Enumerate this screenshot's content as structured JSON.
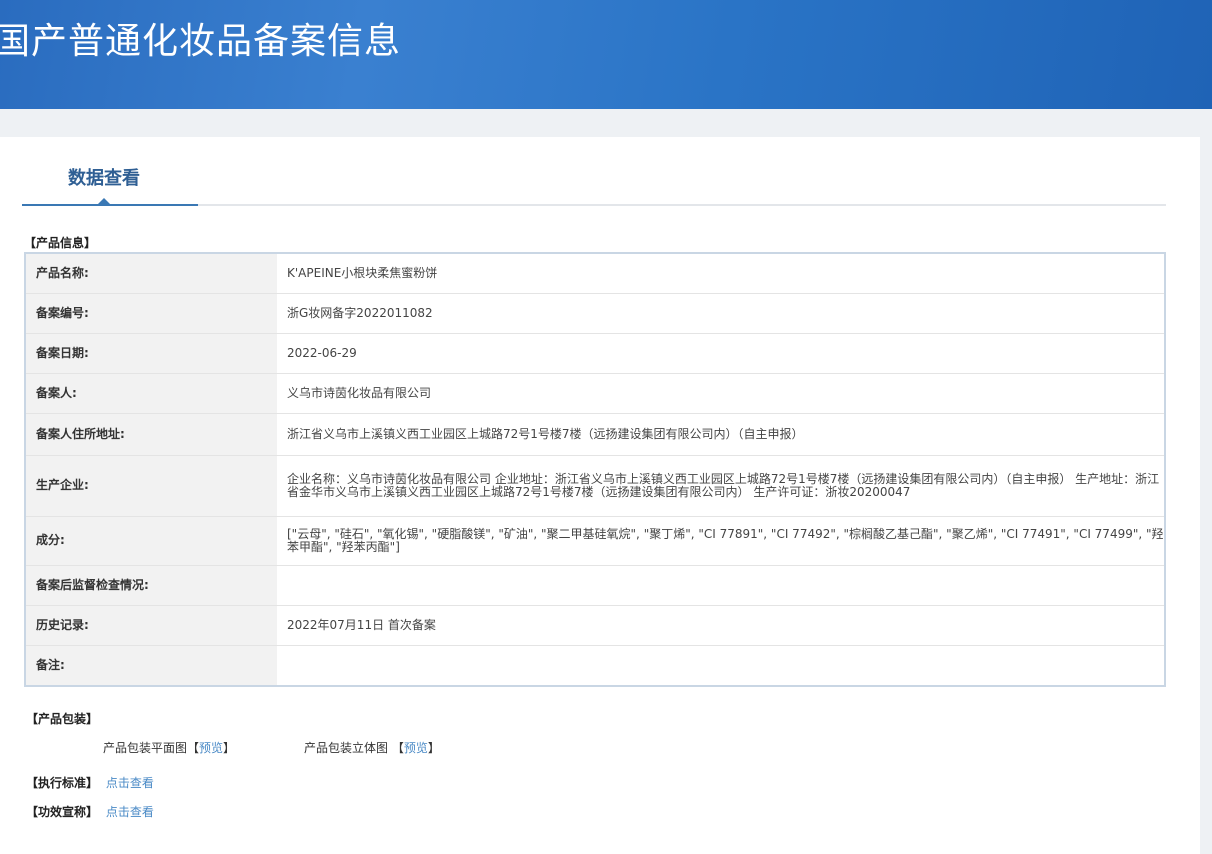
{
  "header": {
    "title": "国产普通化妆品备案信息"
  },
  "tab": {
    "label": "数据查看"
  },
  "product_info": {
    "section_title": "【产品信息】",
    "rows": [
      {
        "label": "产品名称:",
        "value": "K'APEINE小根块柔焦蜜粉饼"
      },
      {
        "label": "备案编号:",
        "value": "浙G妆网备字2022011082"
      },
      {
        "label": "备案日期:",
        "value": "2022-06-29"
      },
      {
        "label": "备案人:",
        "value": "义乌市诗茵化妆品有限公司"
      },
      {
        "label": "备案人住所地址:",
        "value": "浙江省义乌市上溪镇义西工业园区上城路72号1号楼7楼（远扬建设集团有限公司内）（自主申报）"
      },
      {
        "label": "生产企业:",
        "value": "企业名称：义乌市诗茵化妆品有限公司 企业地址：浙江省义乌市上溪镇义西工业园区上城路72号1号楼7楼（远扬建设集团有限公司内）（自主申报） 生产地址：浙江省金华市义乌市上溪镇义西工业园区上城路72号1号楼7楼（远扬建设集团有限公司内） 生产许可证：浙妆20200047"
      },
      {
        "label": "成分:",
        "value": "[\"云母\", \"硅石\", \"氧化锡\", \"硬脂酸镁\", \"矿油\", \"聚二甲基硅氧烷\", \"聚丁烯\", \"CI 77891\", \"CI 77492\", \"棕榈酸乙基己酯\", \"聚乙烯\", \"CI 77491\", \"CI 77499\", \"羟苯甲酯\", \"羟苯丙酯\"]"
      },
      {
        "label": "备案后监督检查情况:",
        "value": ""
      },
      {
        "label": "历史记录:",
        "value": "2022年07月11日 首次备案"
      },
      {
        "label": "备注:",
        "value": ""
      }
    ]
  },
  "packaging": {
    "section_title": "【产品包装】",
    "flat_label": "产品包装平面图",
    "solid_label": "产品包装立体图",
    "bracket_open": "【",
    "bracket_close": "】",
    "preview_link": "预览"
  },
  "standard": {
    "section_title": "【执行标准】",
    "link": "点击查看"
  },
  "efficacy": {
    "section_title": "【功效宣称】",
    "link": "点击查看"
  }
}
